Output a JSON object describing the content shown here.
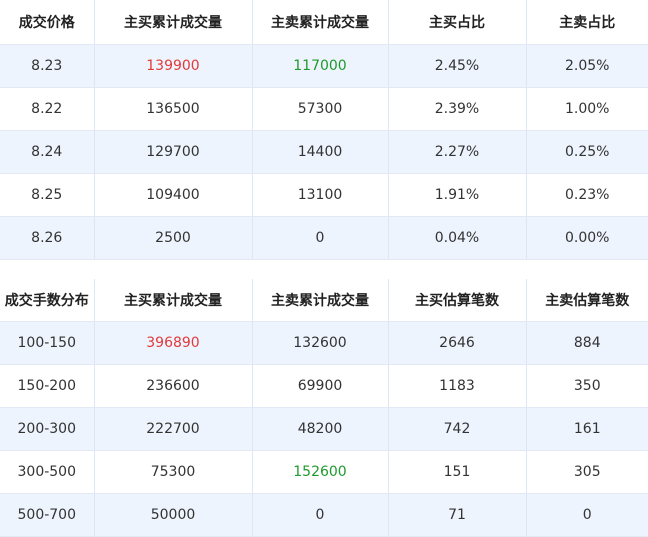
{
  "price_table": {
    "headers": [
      "成交价格",
      "主买累计成交量",
      "主卖累计成交量",
      "主买占比",
      "主卖占比"
    ],
    "rows": [
      {
        "price": "8.23",
        "buy_volume": "139900",
        "sell_volume": "117000",
        "buy_ratio": "2.45%",
        "sell_ratio": "2.05%"
      },
      {
        "price": "8.22",
        "buy_volume": "136500",
        "sell_volume": "57300",
        "buy_ratio": "2.39%",
        "sell_ratio": "1.00%"
      },
      {
        "price": "8.24",
        "buy_volume": "129700",
        "sell_volume": "14400",
        "buy_ratio": "2.27%",
        "sell_ratio": "0.25%"
      },
      {
        "price": "8.25",
        "buy_volume": "109400",
        "sell_volume": "13100",
        "buy_ratio": "1.91%",
        "sell_ratio": "0.23%"
      },
      {
        "price": "8.26",
        "buy_volume": "2500",
        "sell_volume": "0",
        "buy_ratio": "0.04%",
        "sell_ratio": "0.00%"
      }
    ]
  },
  "lot_table": {
    "headers": [
      "成交手数分布",
      "主买累计成交量",
      "主卖累计成交量",
      "主买估算笔数",
      "主卖估算笔数"
    ],
    "rows": [
      {
        "range": "100-150",
        "buy_volume": "396890",
        "sell_volume": "132600",
        "buy_count": "2646",
        "sell_count": "884"
      },
      {
        "range": "150-200",
        "buy_volume": "236600",
        "sell_volume": "69900",
        "buy_count": "1183",
        "sell_count": "350"
      },
      {
        "range": "200-300",
        "buy_volume": "222700",
        "sell_volume": "48200",
        "buy_count": "742",
        "sell_count": "161"
      },
      {
        "range": "300-500",
        "buy_volume": "75300",
        "sell_volume": "152600",
        "buy_count": "151",
        "sell_count": "305"
      },
      {
        "range": "500-700",
        "buy_volume": "50000",
        "sell_volume": "0",
        "buy_count": "71",
        "sell_count": "0"
      }
    ]
  },
  "colors": {
    "highlight_up": "#e03a3a",
    "highlight_down": "#1f9a2d",
    "row_alt_bg": "#eef4fd",
    "border": "#dde6f4"
  }
}
